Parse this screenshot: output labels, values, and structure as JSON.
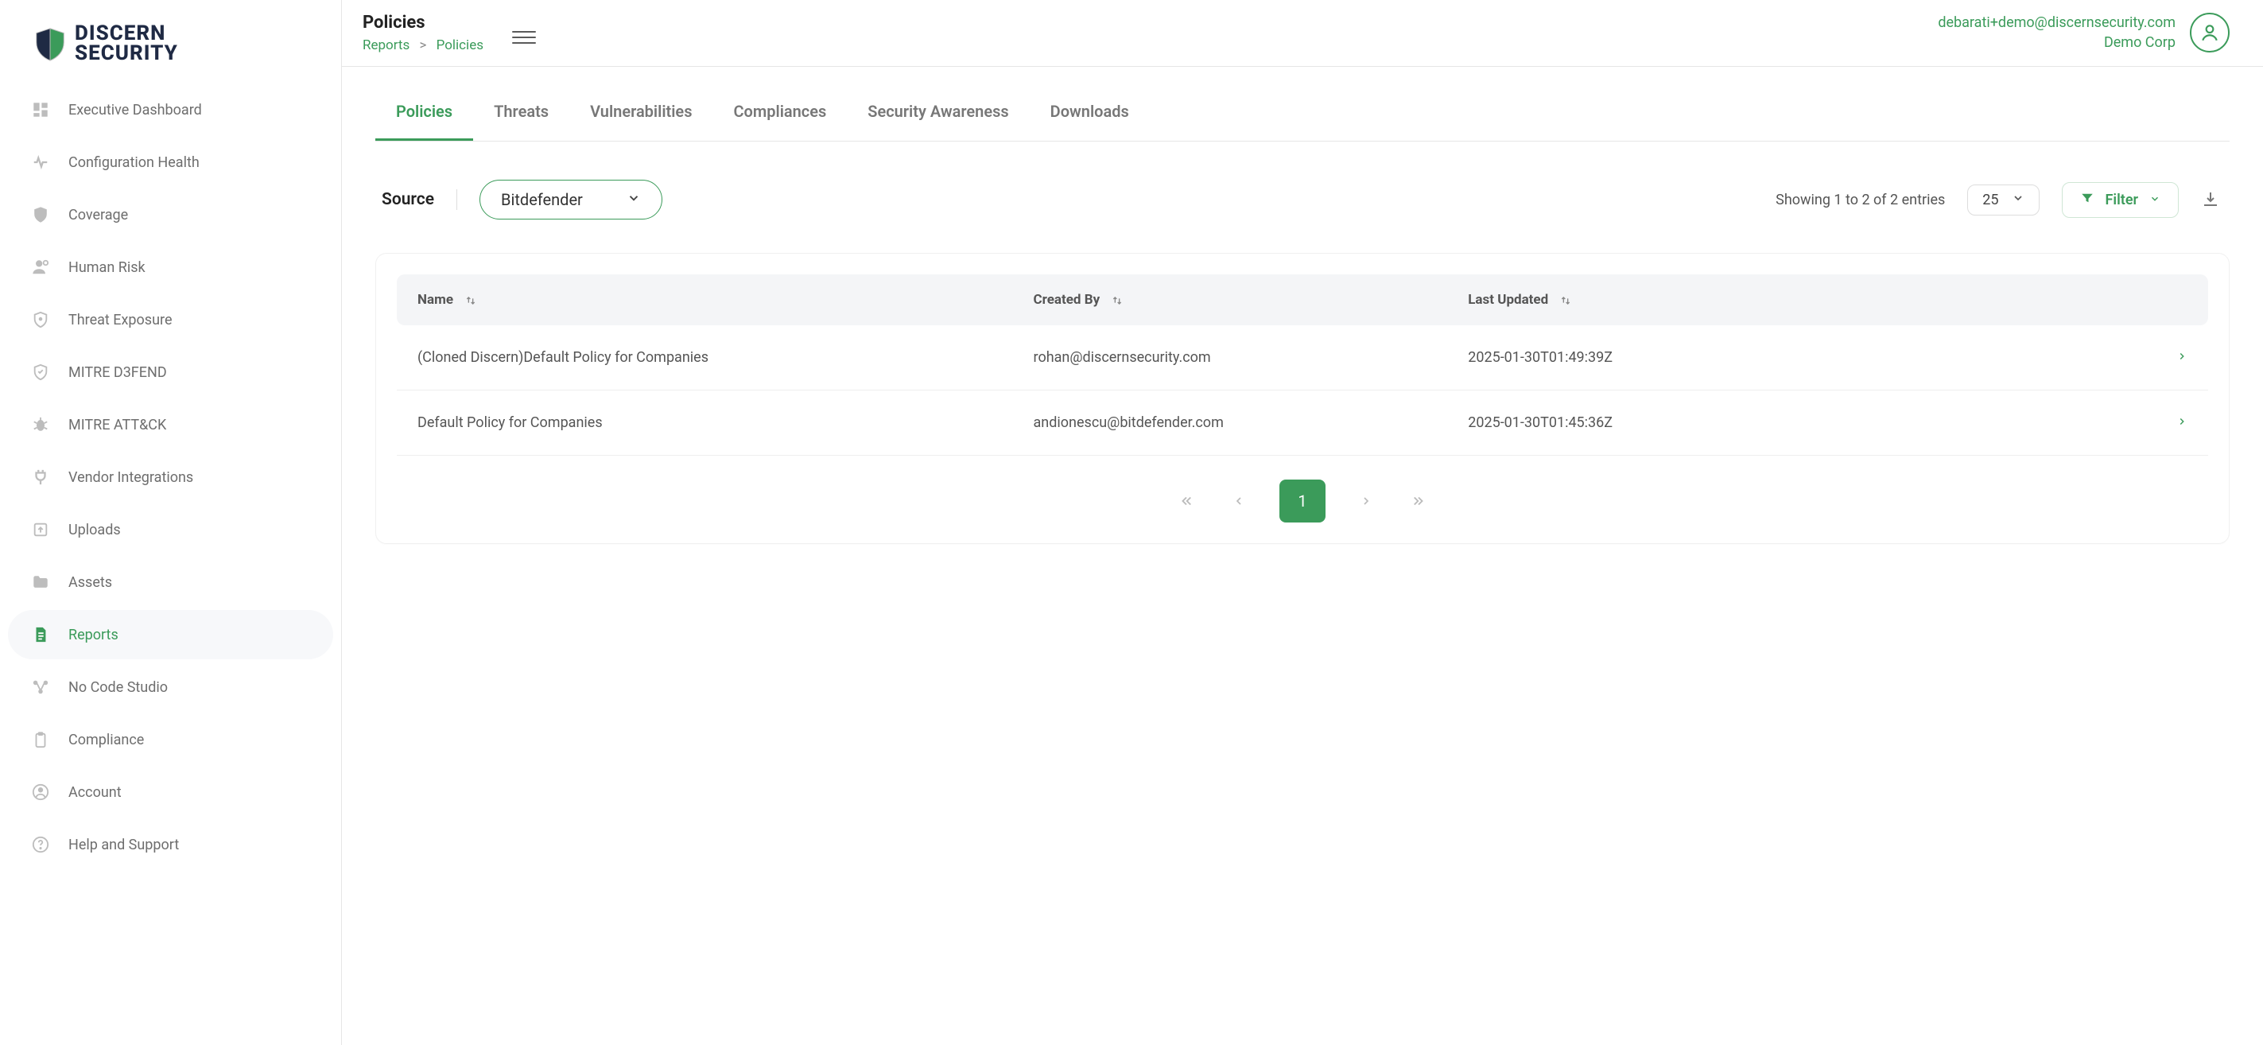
{
  "brand": {
    "line1": "DISCERN",
    "line2": "SECURITY"
  },
  "sidebar": {
    "items": [
      {
        "label": "Executive Dashboard"
      },
      {
        "label": "Configuration Health"
      },
      {
        "label": "Coverage"
      },
      {
        "label": "Human Risk"
      },
      {
        "label": "Threat Exposure"
      },
      {
        "label": "MITRE D3FEND"
      },
      {
        "label": "MITRE ATT&CK"
      },
      {
        "label": "Vendor Integrations"
      },
      {
        "label": "Uploads"
      },
      {
        "label": "Assets"
      },
      {
        "label": "Reports"
      },
      {
        "label": "No Code Studio"
      },
      {
        "label": "Compliance"
      },
      {
        "label": "Account"
      },
      {
        "label": "Help and Support"
      }
    ],
    "active_index": 10
  },
  "header": {
    "title": "Policies",
    "breadcrumb": {
      "root": "Reports",
      "sep": ">",
      "current": "Policies"
    },
    "account": {
      "email": "debarati+demo@discernsecurity.com",
      "org": "Demo Corp"
    }
  },
  "tabs": {
    "items": [
      "Policies",
      "Threats",
      "Vulnerabilities",
      "Compliances",
      "Security Awareness",
      "Downloads"
    ],
    "active_index": 0
  },
  "source": {
    "label": "Source",
    "selected": "Bitdefender"
  },
  "listing": {
    "entries_text": "Showing 1 to 2 of 2 entries",
    "page_size": "25",
    "filter_label": "Filter"
  },
  "table": {
    "columns": [
      "Name",
      "Created By",
      "Last Updated"
    ],
    "rows": [
      {
        "name": "(Cloned Discern)Default Policy for Companies",
        "created_by": "rohan@discernsecurity.com",
        "last_updated": "2025-01-30T01:49:39Z"
      },
      {
        "name": "Default Policy for Companies",
        "created_by": "andionescu@bitdefender.com",
        "last_updated": "2025-01-30T01:45:36Z"
      }
    ]
  },
  "pagination": {
    "current": "1"
  }
}
